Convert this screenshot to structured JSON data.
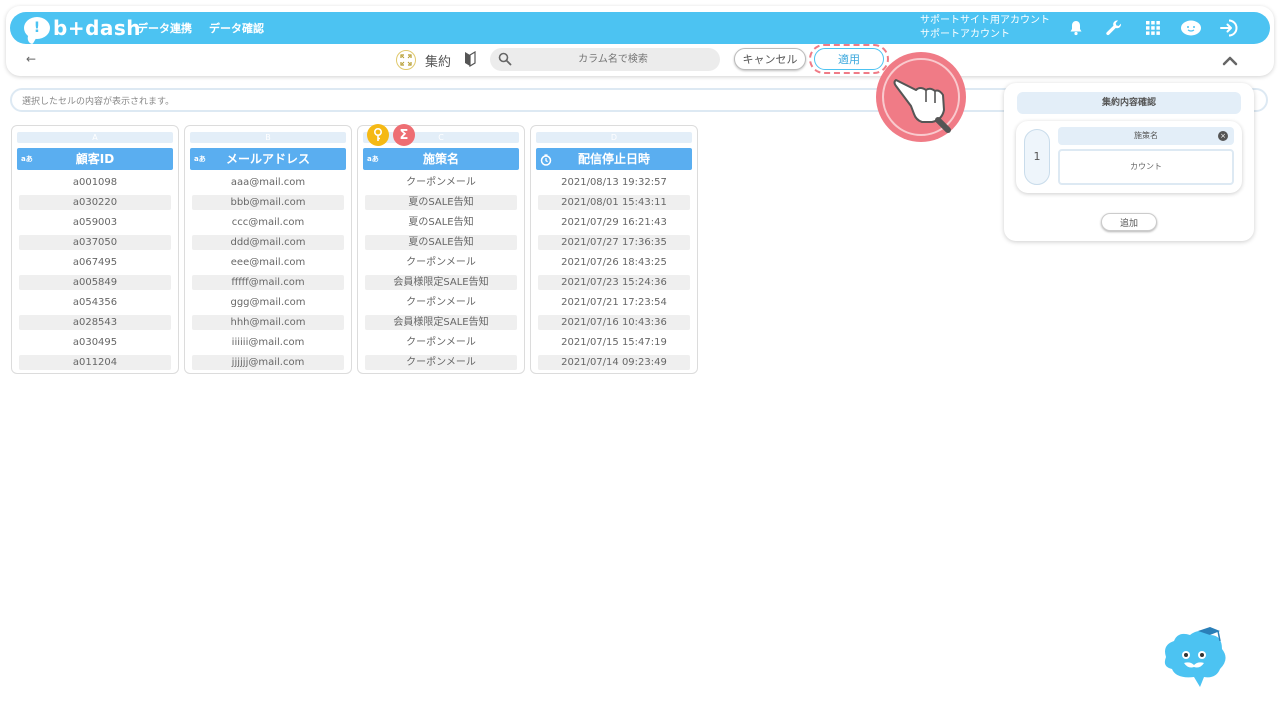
{
  "app": {
    "brand": "b+dash"
  },
  "nav": [
    {
      "label": "データ連携"
    },
    {
      "label": "データ確認"
    }
  ],
  "account": {
    "line1": "サポートサイト用アカウント",
    "line2": "サポートアカウント"
  },
  "icons": {
    "bell": "bell-icon",
    "wrench": "wrench-icon",
    "grid": "grid-icon",
    "mascot": "mascot-icon",
    "logout": "logout-icon"
  },
  "toolbar": {
    "back": "←",
    "aggregate_label": "集約",
    "search_placeholder": "カラム名で検索",
    "cancel_label": "キャンセル",
    "apply_label": "適用"
  },
  "preview": {
    "placeholder": "選択したセルの内容が表示されます。"
  },
  "columns": [
    {
      "letter": "A",
      "type": "aあ",
      "name": "顧客ID",
      "rows": [
        "a001098",
        "a030220",
        "a059003",
        "a037050",
        "a067495",
        "a005849",
        "a054356",
        "a028543",
        "a030495",
        "a011204"
      ]
    },
    {
      "letter": "B",
      "type": "aあ",
      "name": "メールアドレス",
      "rows": [
        "aaa@mail.com",
        "bbb@mail.com",
        "ccc@mail.com",
        "ddd@mail.com",
        "eee@mail.com",
        "fffff@mail.com",
        "ggg@mail.com",
        "hhh@mail.com",
        "iiiiii@mail.com",
        "jjjjjj@mail.com"
      ]
    },
    {
      "letter": "C",
      "type": "aあ",
      "name": "施策名",
      "rows": [
        "クーポンメール",
        "夏のSALE告知",
        "夏のSALE告知",
        "夏のSALE告知",
        "クーポンメール",
        "会員様限定SALE告知",
        "クーポンメール",
        "会員様限定SALE告知",
        "クーポンメール",
        "クーポンメール"
      ]
    },
    {
      "letter": "D",
      "type": "clock",
      "name": "配信停止日時",
      "rows": [
        "2021/08/13 19:32:57",
        "2021/08/01 15:43:11",
        "2021/07/29 16:21:43",
        "2021/07/27 17:36:35",
        "2021/07/26 18:43:25",
        "2021/07/23 15:24:36",
        "2021/07/21 17:23:54",
        "2021/07/16 10:43:36",
        "2021/07/15 15:47:19",
        "2021/07/14 09:23:49"
      ]
    }
  ],
  "badges": {
    "key": "key-icon",
    "sigma": "Σ"
  },
  "panel": {
    "title": "集約内容確認",
    "index": "1",
    "field": "施策名",
    "aggregation": "カウント",
    "add_label": "追加"
  },
  "colors": {
    "brand": "#4cc3f2",
    "header": "#5aaef0",
    "highlight": "#f07b86"
  }
}
